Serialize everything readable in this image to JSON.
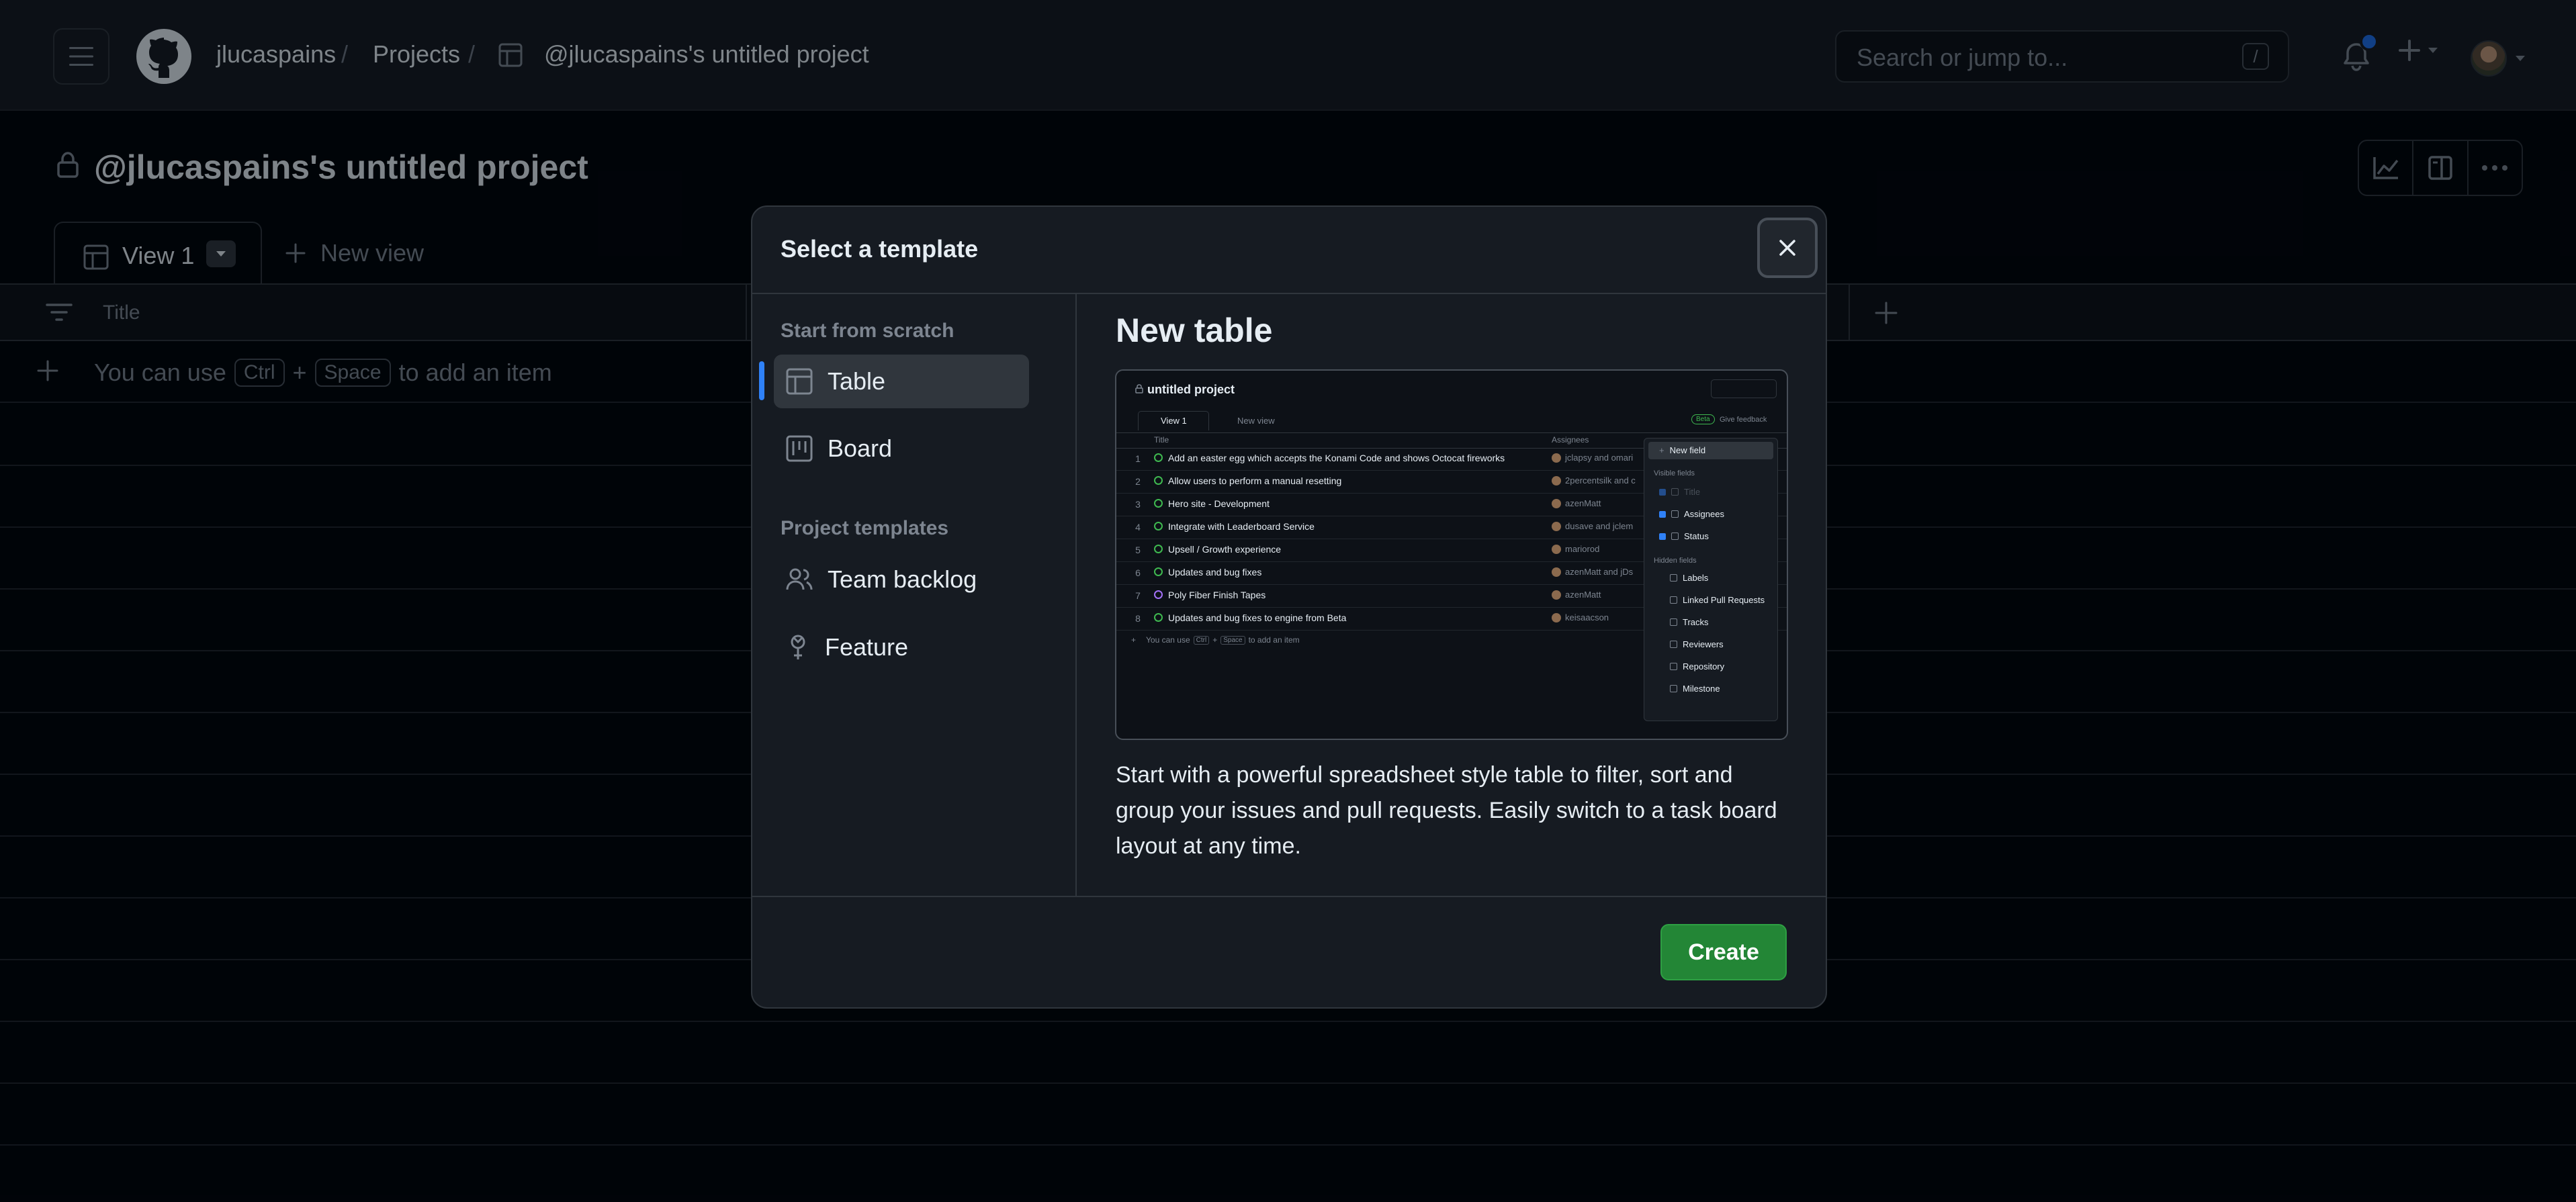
{
  "header": {
    "owner": "jlucaspains",
    "projects_crumb": "Projects",
    "project_crumb": "@jlucaspains's untitled project",
    "separator": "/",
    "search_placeholder": "Search or jump to...",
    "search_shortcut": "/"
  },
  "project": {
    "title": "@jlucaspains's untitled project"
  },
  "views": {
    "tabs": [
      {
        "label": "View 1"
      }
    ],
    "new_view_label": "New view"
  },
  "table": {
    "columns": [
      {
        "label": "Title"
      }
    ],
    "add_item": {
      "prefix": "You can use",
      "key1": "Ctrl",
      "plus": "+",
      "key2": "Space",
      "suffix": "to add an item"
    }
  },
  "modal": {
    "title": "Select a template",
    "sections": [
      {
        "heading": "Start from scratch",
        "items": [
          {
            "label": "Table",
            "icon": "table-icon",
            "selected": true
          },
          {
            "label": "Board",
            "icon": "board-icon",
            "selected": false
          }
        ]
      },
      {
        "heading": "Project templates",
        "items": [
          {
            "label": "Team backlog",
            "icon": "people-icon",
            "selected": false
          },
          {
            "label": "Feature",
            "icon": "feature-icon",
            "selected": false
          }
        ]
      }
    ],
    "preview_title": "New table",
    "description": "Start with a powerful spreadsheet style table to filter, sort and group your issues and pull requests. Easily switch to a task board layout at any time.",
    "create_label": "Create",
    "accent_color": "#238636",
    "selection_color": "#2f81f7"
  },
  "preview": {
    "project_title": "untitled project",
    "view_tab": "View 1",
    "new_view": "New view",
    "beta_badge": "Beta",
    "feedback": "Give feedback",
    "col_title": "Title",
    "col_assignees": "Assignees",
    "rows": [
      {
        "num": "1",
        "title": "Add an easter egg which accepts the Konami Code and shows Octocat fireworks",
        "assignees": "jclapsy and omari"
      },
      {
        "num": "2",
        "title": "Allow users to perform a manual resetting",
        "assignees": "2percentsilk and c"
      },
      {
        "num": "3",
        "title": "Hero site - Development",
        "assignees": "azenMatt"
      },
      {
        "num": "4",
        "title": "Integrate with Leaderboard Service",
        "assignees": "dusave and jclem"
      },
      {
        "num": "5",
        "title": "Upsell / Growth experience",
        "assignees": "mariorod"
      },
      {
        "num": "6",
        "title": "Updates and bug fixes",
        "assignees": "azenMatt and jDs"
      },
      {
        "num": "7",
        "title": "Poly Fiber Finish Tapes",
        "assignees": "azenMatt"
      },
      {
        "num": "8",
        "title": "Updates and bug fixes to engine from Beta",
        "assignees": "keisaacson"
      }
    ],
    "add_hint": {
      "prefix": "You can use",
      "key1": "Ctrl",
      "plus": "+",
      "key2": "Space",
      "suffix": "to add an item"
    },
    "menu": {
      "new_field": "New field",
      "visible_heading": "Visible fields",
      "visible": [
        "Title",
        "Assignees",
        "Status"
      ],
      "hidden_heading": "Hidden fields",
      "hidden": [
        "Labels",
        "Linked Pull Requests",
        "Tracks",
        "Reviewers",
        "Repository",
        "Milestone"
      ]
    }
  }
}
